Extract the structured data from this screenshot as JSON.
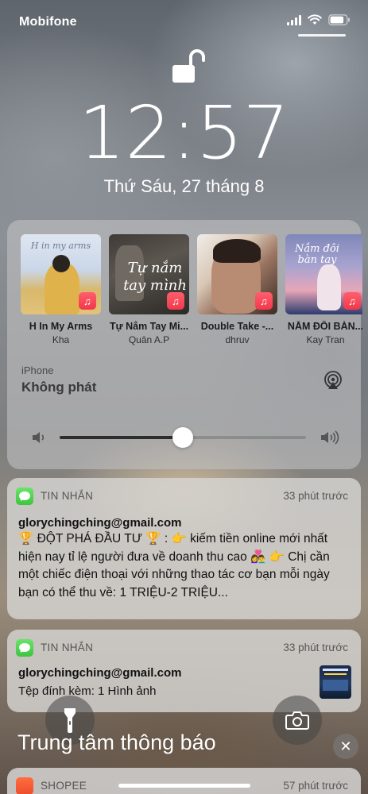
{
  "status_bar": {
    "carrier": "Mobifone",
    "battery_level": 0.85
  },
  "lock": {
    "icon": "lock-open-icon",
    "time": "12:57",
    "date": "Thứ Sáu, 27 tháng 8"
  },
  "music": {
    "albums": [
      {
        "title": "H In My Arms",
        "artist": "Kha",
        "cover_text": "H in my arms"
      },
      {
        "title": "Tự Nắm Tay Mi...",
        "artist": "Quân A.P",
        "cover_text": "Tự nắm tay mình"
      },
      {
        "title": "Double Take -...",
        "artist": "dhruv",
        "cover_text": ""
      },
      {
        "title": "NẮM ĐÔI BÀN...",
        "artist": "Kay Tran",
        "cover_text": "Nắm đôi bàn tay"
      }
    ],
    "device_label": "iPhone",
    "device_state": "Không phát",
    "volume_level": 0.5
  },
  "notifications": [
    {
      "app": "TIN NHẮN",
      "time": "33 phút trước",
      "sender": "glorychingching@gmail.com",
      "body": "🏆 ĐỘT PHÁ ĐẦU TƯ 🏆 : 👉  kiếm tiền online mới nhất hiện nay tỉ lệ người đưa về doanh thu cao 👩‍❤️‍👨 👉 Chị cần một chiếc điện thoại với những thao tác cơ bạn mỗi ngày bạn có thể thu về: 1 TRIỆU-2 TRIỆU..."
    },
    {
      "app": "TIN NHẮN",
      "time": "33 phút trước",
      "sender": "glorychingching@gmail.com",
      "body": "Tệp đính kèm: 1 Hình ảnh"
    }
  ],
  "notification_center": {
    "title": "Trung tâm thông báo",
    "close": "✕"
  },
  "shopee": {
    "app": "SHOPEE",
    "time": "57 phút trước"
  },
  "colors": {
    "music_badge": "#f2384b",
    "messages_icon": "#3cc53f",
    "shopee_icon": "#ee4d2d"
  }
}
